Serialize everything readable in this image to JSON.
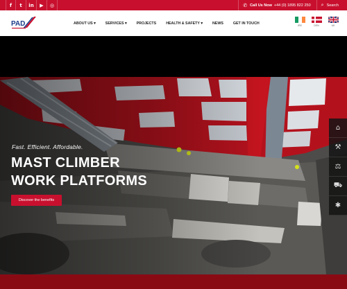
{
  "topbar": {
    "socials": [
      {
        "icon": "facebook-icon",
        "glyph": "f"
      },
      {
        "icon": "twitter-icon",
        "glyph": "t"
      },
      {
        "icon": "linkedin-icon",
        "glyph": "in"
      },
      {
        "icon": "youtube-icon",
        "glyph": "▶"
      },
      {
        "icon": "instagram-icon",
        "glyph": "◎"
      }
    ],
    "phone_label": "Call Us Now",
    "phone_number": "+44 (0) 1895 822 250",
    "search_label": "Search"
  },
  "nav": {
    "logo_text": "PAD",
    "menu": [
      {
        "label": "ABOUT US",
        "dropdown": true
      },
      {
        "label": "SERVICES",
        "dropdown": true
      },
      {
        "label": "PROJECTS",
        "dropdown": false
      },
      {
        "label": "HEALTH & SAFETY",
        "dropdown": true
      },
      {
        "label": "NEWS",
        "dropdown": false
      },
      {
        "label": "GET IN TOUCH",
        "dropdown": false
      }
    ],
    "menu_labels": [
      "ABOUT US ▾",
      "SERVICES ▾",
      "PROJECTS",
      "HEALTH & SAFETY ▾",
      "NEWS",
      "GET IN TOUCH"
    ],
    "flags": [
      {
        "code": "IRE",
        "label": "IRE"
      },
      {
        "code": "DEN",
        "label": "DEN"
      },
      {
        "code": "UK",
        "label": "UK"
      }
    ]
  },
  "hero": {
    "tagline": "Fast. Efficient. Affordable.",
    "headline_line1": "MAST CLIMBER",
    "headline_line2": "WORK PLATFORMS",
    "cta_label": "Discover the benefits"
  },
  "dock": [
    {
      "icon": "building-icon",
      "glyph": "⌂"
    },
    {
      "icon": "crane-icon",
      "glyph": "⚒"
    },
    {
      "icon": "platform-icon",
      "glyph": "⚖"
    },
    {
      "icon": "truck-icon",
      "glyph": "⛟"
    },
    {
      "icon": "lightbulb-icon",
      "glyph": "✱"
    }
  ],
  "colors": {
    "brand_red": "#c8102e",
    "dark_red": "#8a0a14",
    "nav_bg": "#ffffff",
    "band_bg": "#000000"
  }
}
